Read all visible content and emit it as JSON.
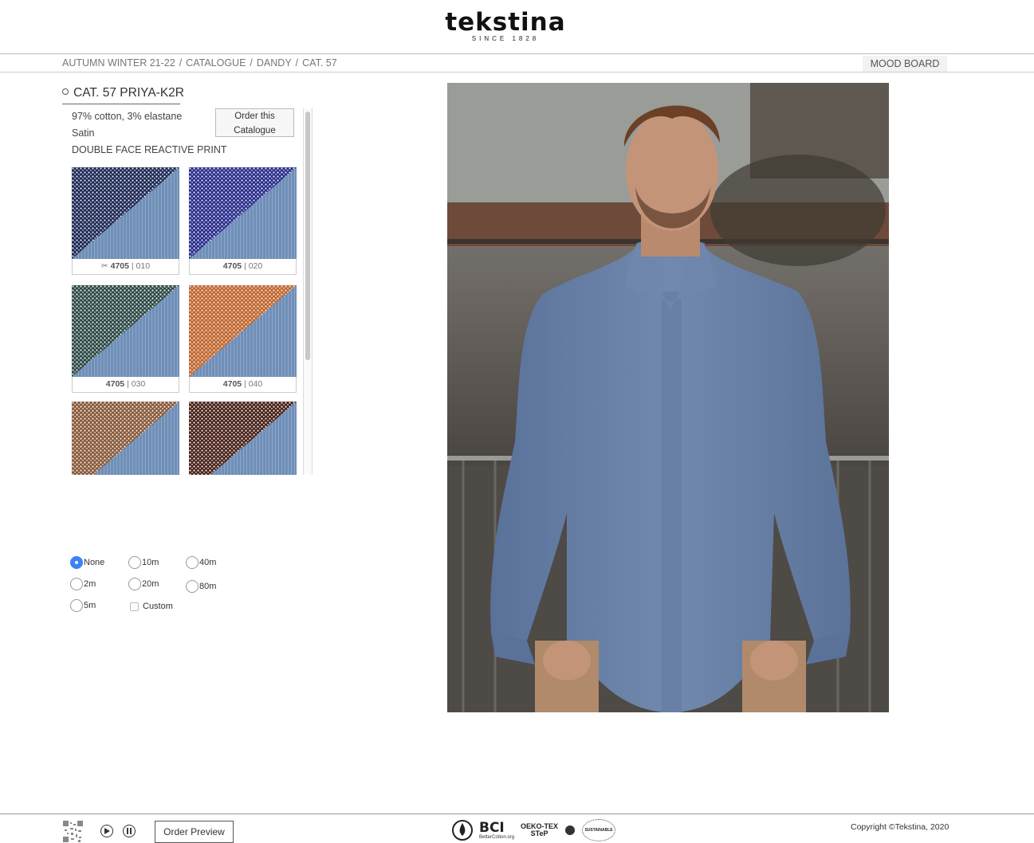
{
  "brand": {
    "name": "tekstina",
    "since": "SINCE 1828"
  },
  "breadcrumb": [
    "AUTUMN WINTER 21-22",
    "CATALOGUE",
    "DANDY",
    "CAT. 57"
  ],
  "header": {
    "mood_board_label": "MOOD BOARD"
  },
  "product": {
    "title": "CAT. 57 PRIYA-K2R",
    "composition": "97% cotton, 3% elastane",
    "weave": "Satin",
    "finish": "DOUBLE FACE REACTIVE PRINT",
    "order_button": [
      "Order this",
      "Catalogue"
    ]
  },
  "swatches": [
    {
      "article": "4705",
      "color": "010",
      "icon": "scissors-icon",
      "print_color": "#1e2a55"
    },
    {
      "article": "4705",
      "color": "020",
      "icon": "",
      "print_color": "#2a2c8c"
    },
    {
      "article": "4705",
      "color": "030",
      "icon": "",
      "print_color": "#2d4a46"
    },
    {
      "article": "4705",
      "color": "040",
      "icon": "",
      "print_color": "#c2652a"
    },
    {
      "article": "",
      "color": "",
      "icon": "",
      "print_color": "#8a5a3a"
    },
    {
      "article": "",
      "color": "",
      "icon": "",
      "print_color": "#4a2218"
    }
  ],
  "quantity_options": {
    "selected": "None",
    "options": [
      "None",
      "10m",
      "40m",
      "2m",
      "20m",
      "80m",
      "5m"
    ],
    "custom_label": "Custom"
  },
  "footer": {
    "order_preview_label": "Order Preview",
    "certifications": [
      "BCI",
      "BetterCotton.org",
      "OEKO-TEX",
      "STeP",
      "SUSTAINABLE"
    ],
    "copyright": "Copyright ©Tekstina, 2020"
  },
  "colors": {
    "base_fabric": "#6f8fb8",
    "shirt": "#6d86ab"
  }
}
